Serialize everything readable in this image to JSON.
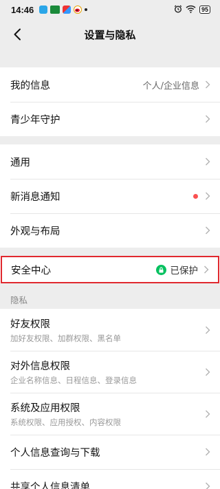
{
  "status_bar": {
    "time": "14:46",
    "battery": "95",
    "icons": [
      "app-notification-1",
      "app-notification-2",
      "app-notification-3",
      "weibo-icon",
      "more-dot",
      "alarm-icon",
      "wifi-icon",
      "battery-icon"
    ]
  },
  "nav": {
    "title": "设置与隐私"
  },
  "group1": {
    "my_info": {
      "label": "我的信息",
      "value": "个人/企业信息"
    },
    "youth": {
      "label": "青少年守护"
    }
  },
  "group2": {
    "general": {
      "label": "通用"
    },
    "notify": {
      "label": "新消息通知",
      "has_dot": true
    },
    "appearance": {
      "label": "外观与布局"
    }
  },
  "security": {
    "label": "安全中心",
    "status": "已保护"
  },
  "privacy": {
    "header": "隐私",
    "items": [
      {
        "label": "好友权限",
        "sub": "加好友权限、加群权限、黑名单"
      },
      {
        "label": "对外信息权限",
        "sub": "企业名称信息、日程信息、登录信息"
      },
      {
        "label": "系统及应用权限",
        "sub": "系统权限、应用授权、内容权限"
      },
      {
        "label": "个人信息查询与下载"
      },
      {
        "label": "共享个人信息清单"
      }
    ]
  },
  "colors": {
    "background": "#ededed",
    "accent_green": "#07c160",
    "alert_red": "#fa5151",
    "highlight_border": "#e0282e"
  }
}
